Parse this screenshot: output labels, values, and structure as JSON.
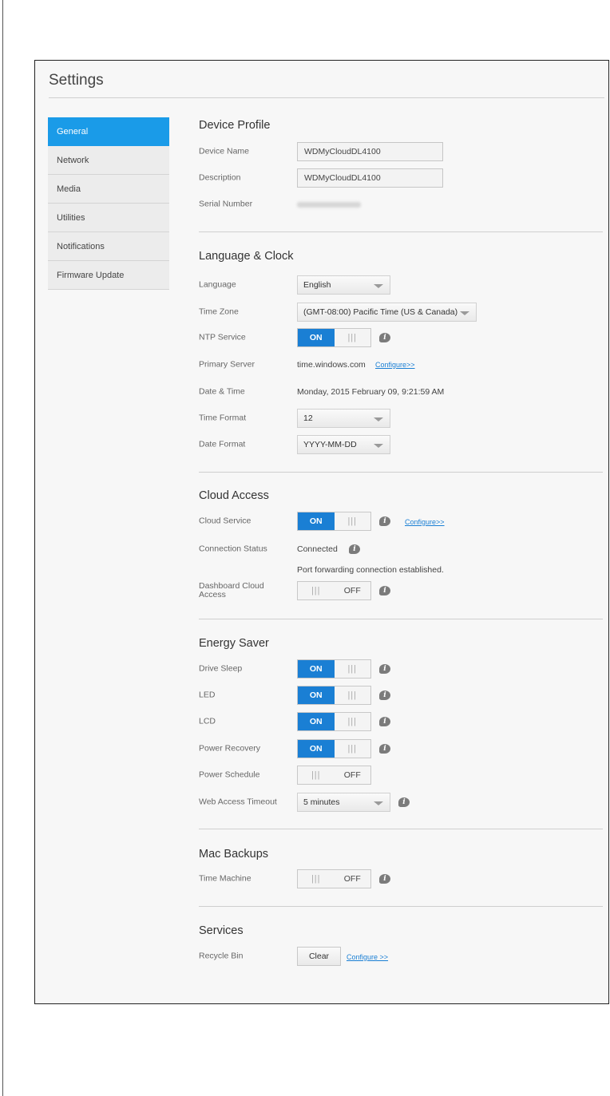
{
  "page_title": "Settings",
  "sidebar": {
    "items": [
      {
        "label": "General",
        "active": true
      },
      {
        "label": "Network"
      },
      {
        "label": "Media"
      },
      {
        "label": "Utilities"
      },
      {
        "label": "Notifications"
      },
      {
        "label": "Firmware Update"
      }
    ]
  },
  "device_profile": {
    "title": "Device Profile",
    "device_name_label": "Device Name",
    "device_name_value": "WDMyCloudDL4100",
    "description_label": "Description",
    "description_value": "WDMyCloudDL4100",
    "serial_label": "Serial Number"
  },
  "language_clock": {
    "title": "Language & Clock",
    "language_label": "Language",
    "language_value": "English",
    "timezone_label": "Time Zone",
    "timezone_value": "(GMT-08:00) Pacific Time (US & Canada)",
    "ntp_label": "NTP Service",
    "primary_server_label": "Primary Server",
    "primary_server_value": "time.windows.com",
    "configure_link": "Configure>>",
    "datetime_label": "Date & Time",
    "datetime_value": "Monday, 2015 February 09, 9:21:59 AM",
    "time_format_label": "Time Format",
    "time_format_value": "12",
    "date_format_label": "Date Format",
    "date_format_value": "YYYY-MM-DD"
  },
  "cloud_access": {
    "title": "Cloud Access",
    "cloud_service_label": "Cloud Service",
    "configure_link": "Configure>>",
    "connection_status_label": "Connection Status",
    "connection_status_value": "Connected",
    "port_forwarding_text": "Port forwarding connection established.",
    "dashboard_label": "Dashboard Cloud Access"
  },
  "energy_saver": {
    "title": "Energy Saver",
    "drive_sleep_label": "Drive Sleep",
    "led_label": "LED",
    "lcd_label": "LCD",
    "power_recovery_label": "Power Recovery",
    "power_schedule_label": "Power Schedule",
    "web_timeout_label": "Web Access Timeout",
    "web_timeout_value": "5 minutes"
  },
  "mac_backups": {
    "title": "Mac Backups",
    "time_machine_label": "Time Machine"
  },
  "services": {
    "title": "Services",
    "recycle_bin_label": "Recycle Bin",
    "clear_label": "Clear",
    "configure_link": "Configure >>"
  },
  "toggle": {
    "on": "ON",
    "off": "OFF",
    "grip": "|||"
  },
  "colors": {
    "accent": "#1a9be8",
    "toggle_on": "#1a7fd4"
  }
}
